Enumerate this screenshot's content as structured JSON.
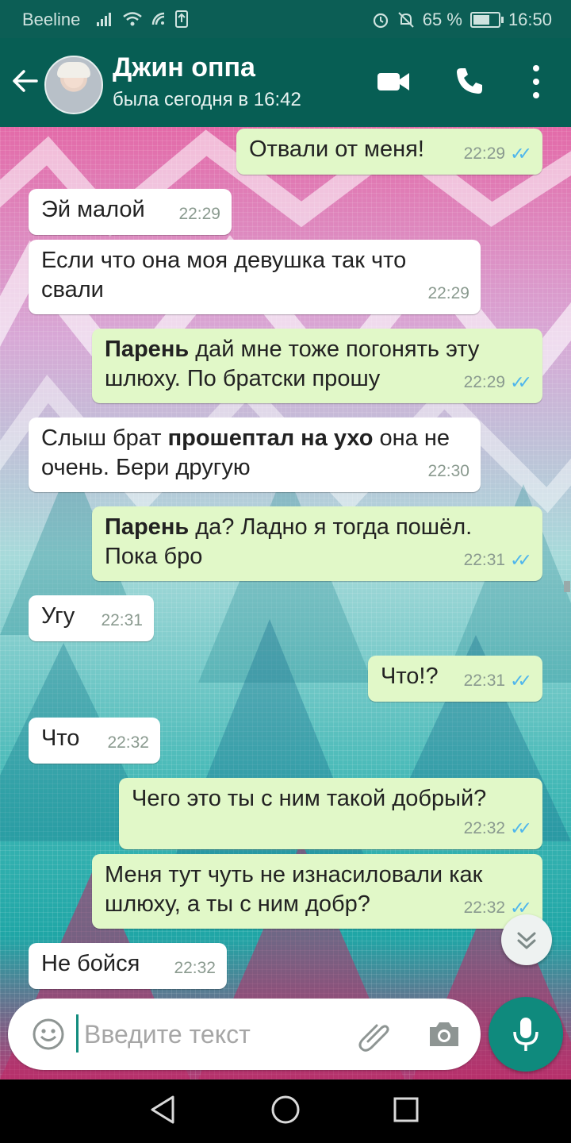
{
  "status_bar": {
    "carrier": "Beeline",
    "battery": "65 %",
    "time": "16:50"
  },
  "header": {
    "contact_name": "Джин оппа",
    "last_seen": "была сегодня в 16:42"
  },
  "messages": [
    {
      "dir": "out",
      "bold": "",
      "text": "Отвали от меня!",
      "time": "22:29"
    },
    {
      "dir": "in",
      "bold": "",
      "text": "Эй малой",
      "time": "22:29"
    },
    {
      "dir": "in",
      "bold": "",
      "text": "Если что она моя девушка так что свали",
      "time": "22:29"
    },
    {
      "dir": "out",
      "bold": "Парень",
      "text": " дай мне тоже погонять эту шлюху. По братски прошу",
      "time": "22:29"
    },
    {
      "dir": "in",
      "pre": "Слыш брат ",
      "bold": "прошептал на ухо",
      "text": " она не очень. Бери другую",
      "time": "22:30"
    },
    {
      "dir": "out",
      "bold": "Парень",
      "text": " да? Ладно я тогда пошёл. Пока бро",
      "time": "22:31"
    },
    {
      "dir": "in",
      "bold": "",
      "text": "Угу",
      "time": "22:31"
    },
    {
      "dir": "out",
      "bold": "",
      "text": "Что!?",
      "time": "22:31"
    },
    {
      "dir": "in",
      "bold": "",
      "text": "Что",
      "time": "22:32"
    },
    {
      "dir": "out",
      "bold": "",
      "text": "Чего это ты с ним такой добрый?",
      "time": "22:32"
    },
    {
      "dir": "out",
      "bold": "",
      "text": "Меня тут чуть не изнасиловали как шлюху, а ты с ним добр?",
      "time": "22:32"
    },
    {
      "dir": "in",
      "bold": "",
      "text": "Не бойся",
      "time": "22:32"
    }
  ],
  "composer": {
    "placeholder": "Введите текст"
  },
  "colors": {
    "header": "#075e54",
    "outgoing_bubble": "#e1f8c8",
    "incoming_bubble": "#ffffff",
    "read_ticks": "#4fb6ec",
    "mic_button": "#0f8a7d"
  },
  "icons": [
    "back-arrow-icon",
    "video-call-icon",
    "phone-icon",
    "more-vert-icon",
    "double-chevron-down-icon",
    "emoji-icon",
    "paperclip-icon",
    "camera-icon",
    "mic-icon",
    "nav-back-icon",
    "nav-home-icon",
    "nav-recents-icon"
  ]
}
